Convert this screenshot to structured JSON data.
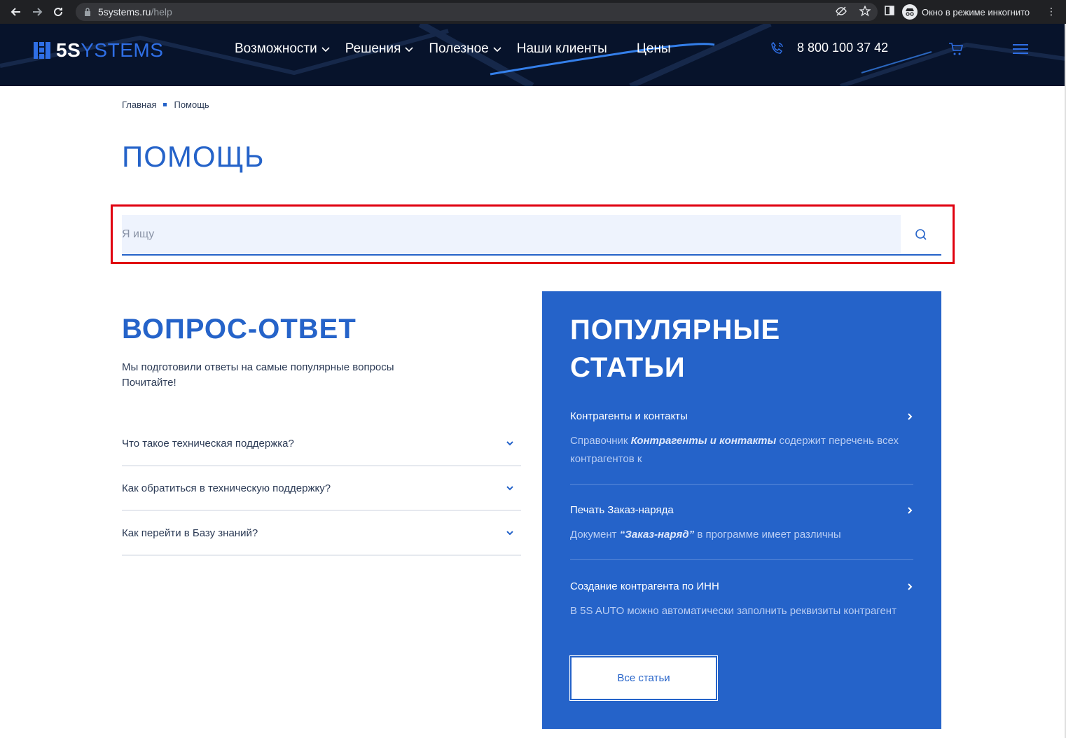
{
  "browser": {
    "url_host": "5systems.ru",
    "url_path": "/help",
    "incognito_label": "Окно в режиме инкогнито"
  },
  "header": {
    "logo_bold": "5S",
    "logo_rest": "YSTEMS",
    "nav": [
      {
        "label": "Возможности",
        "has_dropdown": true
      },
      {
        "label": "Решения",
        "has_dropdown": true
      },
      {
        "label": "Полезное",
        "has_dropdown": true
      },
      {
        "label": "Наши клиенты",
        "has_dropdown": false
      },
      {
        "label": "Цены",
        "has_dropdown": false
      }
    ],
    "phone": "8 800 100 37 42"
  },
  "breadcrumb": [
    "Главная",
    "Помощь"
  ],
  "page_title": "ПОМОЩЬ",
  "search": {
    "placeholder": "Я ищу",
    "value": ""
  },
  "faq": {
    "title": "ВОПРОС-ОТВЕТ",
    "desc_line1": "Мы подготовили ответы на самые популярные вопросы",
    "desc_line2": "Почитайте!",
    "items": [
      "Что такое техническая поддержка?",
      "Как обратиться в техническую поддержку?",
      "Как перейти в Базу знаний?"
    ]
  },
  "popular": {
    "title": "ПОПУЛЯРНЫЕ СТАТЬИ",
    "articles": [
      {
        "title": "Контрагенты и контакты",
        "desc_pre": "Справочник ",
        "desc_bold": "Контрагенты и контакты",
        "desc_post": " содержит перечень всех контрагентов к"
      },
      {
        "title": "Печать Заказ-наряда",
        "desc_pre": "Документ ",
        "desc_bold": "“Заказ-наряд”",
        "desc_post": " в программе имеет различны"
      },
      {
        "title": "Создание контрагента по ИНН",
        "desc_pre": "В 5S AUTO можно автоматически заполнить реквизиты контрагент",
        "desc_bold": "",
        "desc_post": ""
      }
    ],
    "all_button": "Все статьи"
  },
  "colors": {
    "accent": "#2563c9",
    "header_bg": "#07132b",
    "highlight": "#e0000f"
  }
}
